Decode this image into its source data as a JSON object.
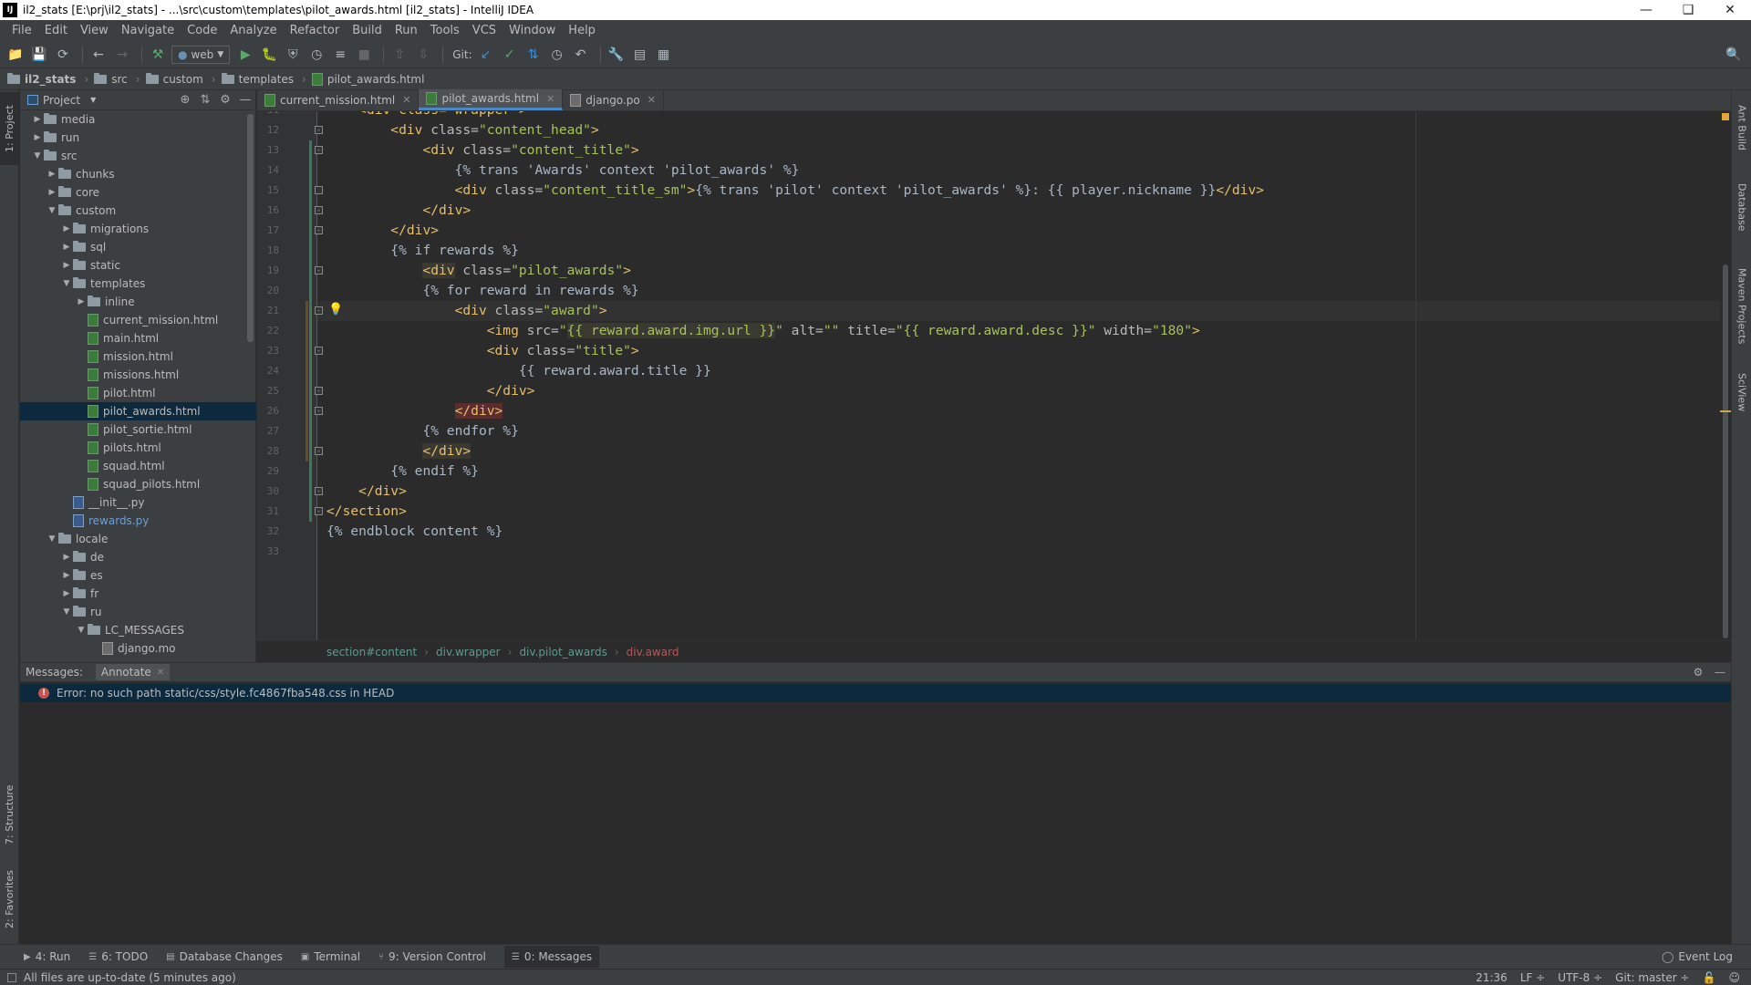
{
  "window": {
    "title": "il2_stats [E:\\prj\\il2_stats] - ...\\src\\custom\\templates\\pilot_awards.html [il2_stats] - IntelliJ IDEA",
    "app_icon": "IJ"
  },
  "menu": [
    "File",
    "Edit",
    "View",
    "Navigate",
    "Code",
    "Analyze",
    "Refactor",
    "Build",
    "Run",
    "Tools",
    "VCS",
    "Window",
    "Help"
  ],
  "toolbar": {
    "run_config": "web",
    "git_label": "Git:"
  },
  "breadcrumb": [
    "il2_stats",
    "src",
    "custom",
    "templates",
    "pilot_awards.html"
  ],
  "left_tabs": {
    "project": "1: Project",
    "structure": "7: Structure",
    "favorites": "2: Favorites"
  },
  "right_tabs": [
    "Ant Build",
    "Database",
    "Maven Projects",
    "SciView"
  ],
  "project_panel": {
    "title": "Project",
    "tree": [
      {
        "label": "media",
        "type": "folder",
        "depth": 1,
        "expanded": false
      },
      {
        "label": "run",
        "type": "folder",
        "depth": 1,
        "expanded": false
      },
      {
        "label": "src",
        "type": "folder",
        "depth": 1,
        "expanded": true
      },
      {
        "label": "chunks",
        "type": "folder",
        "depth": 2,
        "expanded": false
      },
      {
        "label": "core",
        "type": "folder",
        "depth": 2,
        "expanded": false
      },
      {
        "label": "custom",
        "type": "folder",
        "depth": 2,
        "expanded": true
      },
      {
        "label": "migrations",
        "type": "folder",
        "depth": 3,
        "expanded": false
      },
      {
        "label": "sql",
        "type": "folder",
        "depth": 3,
        "expanded": false
      },
      {
        "label": "static",
        "type": "folder",
        "depth": 3,
        "expanded": false
      },
      {
        "label": "templates",
        "type": "folder",
        "depth": 3,
        "expanded": true
      },
      {
        "label": "inline",
        "type": "folder",
        "depth": 4,
        "expanded": false
      },
      {
        "label": "current_mission.html",
        "type": "html",
        "depth": 4
      },
      {
        "label": "main.html",
        "type": "html",
        "depth": 4
      },
      {
        "label": "mission.html",
        "type": "html",
        "depth": 4
      },
      {
        "label": "missions.html",
        "type": "html",
        "depth": 4
      },
      {
        "label": "pilot.html",
        "type": "html",
        "depth": 4
      },
      {
        "label": "pilot_awards.html",
        "type": "html",
        "depth": 4,
        "selected": true
      },
      {
        "label": "pilot_sortie.html",
        "type": "html",
        "depth": 4
      },
      {
        "label": "pilots.html",
        "type": "html",
        "depth": 4
      },
      {
        "label": "squad.html",
        "type": "html",
        "depth": 4
      },
      {
        "label": "squad_pilots.html",
        "type": "html",
        "depth": 4
      },
      {
        "label": "__init__.py",
        "type": "py",
        "depth": 3
      },
      {
        "label": "rewards.py",
        "type": "py",
        "depth": 3,
        "modified": true
      },
      {
        "label": "locale",
        "type": "folder",
        "depth": 2,
        "expanded": true
      },
      {
        "label": "de",
        "type": "folder",
        "depth": 3,
        "expanded": false
      },
      {
        "label": "es",
        "type": "folder",
        "depth": 3,
        "expanded": false
      },
      {
        "label": "fr",
        "type": "folder",
        "depth": 3,
        "expanded": false
      },
      {
        "label": "ru",
        "type": "folder",
        "depth": 3,
        "expanded": true
      },
      {
        "label": "LC_MESSAGES",
        "type": "folder",
        "depth": 4,
        "expanded": true
      },
      {
        "label": "django.mo",
        "type": "po",
        "depth": 5
      }
    ]
  },
  "editor_tabs": [
    {
      "label": "current_mission.html",
      "type": "html",
      "active": false
    },
    {
      "label": "pilot_awards.html",
      "type": "html",
      "active": true
    },
    {
      "label": "django.po",
      "type": "po",
      "active": false
    }
  ],
  "editor": {
    "lines": [
      {
        "n": "11",
        "segs": [
          [
            "    ",
            ""
          ],
          [
            "<div class=\"wrapper\">",
            "tag"
          ]
        ]
      },
      {
        "n": "12",
        "segs": [
          [
            "        ",
            ""
          ],
          [
            "<div ",
            "tag"
          ],
          [
            "class=",
            "attr"
          ],
          [
            "\"content_head\"",
            "str"
          ],
          [
            ">",
            "tag"
          ]
        ]
      },
      {
        "n": "13",
        "segs": [
          [
            "            ",
            ""
          ],
          [
            "<div ",
            "tag"
          ],
          [
            "class=",
            "attr"
          ],
          [
            "\"content_title\"",
            "str"
          ],
          [
            ">",
            "tag"
          ]
        ]
      },
      {
        "n": "14",
        "segs": [
          [
            "                ",
            ""
          ],
          [
            "{% trans 'Awards' context 'pilot_awards' %}",
            "tpl"
          ]
        ]
      },
      {
        "n": "15",
        "segs": [
          [
            "                ",
            ""
          ],
          [
            "<div ",
            "tag"
          ],
          [
            "class=",
            "attr"
          ],
          [
            "\"content_title_sm\"",
            "str"
          ],
          [
            ">",
            "tag"
          ],
          [
            "{% trans 'pilot' context 'pilot_awards' %}: {{ player.nickname }}",
            "tpl"
          ],
          [
            "</div>",
            "tag"
          ]
        ]
      },
      {
        "n": "16",
        "segs": [
          [
            "            ",
            ""
          ],
          [
            "</div>",
            "tag"
          ]
        ]
      },
      {
        "n": "17",
        "segs": [
          [
            "        ",
            ""
          ],
          [
            "</div>",
            "tag"
          ]
        ]
      },
      {
        "n": "18",
        "segs": [
          [
            "        ",
            ""
          ],
          [
            "{% if rewards %}",
            "tpl"
          ]
        ]
      },
      {
        "n": "19",
        "segs": [
          [
            "            ",
            ""
          ],
          [
            "<div",
            "tag hl"
          ],
          [
            " ",
            ""
          ],
          [
            "class=",
            "attr"
          ],
          [
            "\"pilot_awards\"",
            "str"
          ],
          [
            ">",
            "tag"
          ]
        ]
      },
      {
        "n": "20",
        "segs": [
          [
            "            ",
            ""
          ],
          [
            "{% for reward in rewards %}",
            "tpl"
          ]
        ]
      },
      {
        "n": "21",
        "segs": [
          [
            "                ",
            ""
          ],
          [
            "<div ",
            "tag"
          ],
          [
            "class=",
            "attr"
          ],
          [
            "\"award\"",
            "str"
          ],
          [
            ">",
            "tag"
          ]
        ],
        "caret": true
      },
      {
        "n": "22",
        "segs": [
          [
            "                    ",
            ""
          ],
          [
            "<img ",
            "tag"
          ],
          [
            "src=",
            "attr"
          ],
          [
            "\"",
            "str"
          ],
          [
            "{{ reward.award.img.url }}",
            "str hl"
          ],
          [
            "\" ",
            "str"
          ],
          [
            "alt=",
            "attr"
          ],
          [
            "\"\" ",
            "str"
          ],
          [
            "title=",
            "attr"
          ],
          [
            "\"{{ reward.award.desc }}\" ",
            "str"
          ],
          [
            "width=",
            "attr"
          ],
          [
            "\"180\"",
            "str"
          ],
          [
            ">",
            "tag"
          ]
        ]
      },
      {
        "n": "23",
        "segs": [
          [
            "                    ",
            ""
          ],
          [
            "<div ",
            "tag"
          ],
          [
            "class=",
            "attr"
          ],
          [
            "\"title\"",
            "str"
          ],
          [
            ">",
            "tag"
          ]
        ]
      },
      {
        "n": "24",
        "segs": [
          [
            "                        ",
            ""
          ],
          [
            "{{ reward.award.title }}",
            "tpl"
          ]
        ]
      },
      {
        "n": "25",
        "segs": [
          [
            "                    ",
            ""
          ],
          [
            "</div>",
            "tag"
          ]
        ]
      },
      {
        "n": "26",
        "segs": [
          [
            "                ",
            ""
          ],
          [
            "</div>",
            "tag redhl"
          ]
        ]
      },
      {
        "n": "27",
        "segs": [
          [
            "            ",
            ""
          ],
          [
            "{% endfor %}",
            "tpl"
          ]
        ]
      },
      {
        "n": "28",
        "segs": [
          [
            "            ",
            ""
          ],
          [
            "</div>",
            "tag hl"
          ]
        ]
      },
      {
        "n": "29",
        "segs": [
          [
            "        ",
            ""
          ],
          [
            "{% endif %}",
            "tpl"
          ]
        ]
      },
      {
        "n": "30",
        "segs": [
          [
            "    ",
            ""
          ],
          [
            "</div>",
            "tag"
          ]
        ]
      },
      {
        "n": "31",
        "segs": [
          [
            "",
            ""
          ],
          [
            "</section>",
            "tag"
          ]
        ]
      },
      {
        "n": "32",
        "segs": [
          [
            "{% endblock content %}",
            "tpl"
          ]
        ]
      },
      {
        "n": "33",
        "segs": [
          [
            "",
            ""
          ]
        ]
      }
    ]
  },
  "editor_breadcrumb": [
    "section#content",
    "div.wrapper",
    "div.pilot_awards",
    "div.award"
  ],
  "messages": {
    "tabs": [
      "Messages:",
      "Annotate"
    ],
    "error": "Error: no such path static/css/style.fc4867fba548.css in HEAD"
  },
  "bottom_tools": [
    {
      "label": "4: Run",
      "icon": "run-icon"
    },
    {
      "label": "6: TODO",
      "icon": "todo-icon"
    },
    {
      "label": "Database Changes",
      "icon": "database-changes-icon"
    },
    {
      "label": "Terminal",
      "icon": "terminal-icon"
    },
    {
      "label": "9: Version Control",
      "icon": "version-control-icon"
    },
    {
      "label": "0: Messages",
      "icon": "messages-icon",
      "active": true
    }
  ],
  "event_log": "Event Log",
  "status": {
    "message": "All files are up-to-date (5 minutes ago)",
    "position": "21:36",
    "line_sep": "LF ÷",
    "encoding": "UTF-8 ÷",
    "git": "Git: master ÷"
  }
}
